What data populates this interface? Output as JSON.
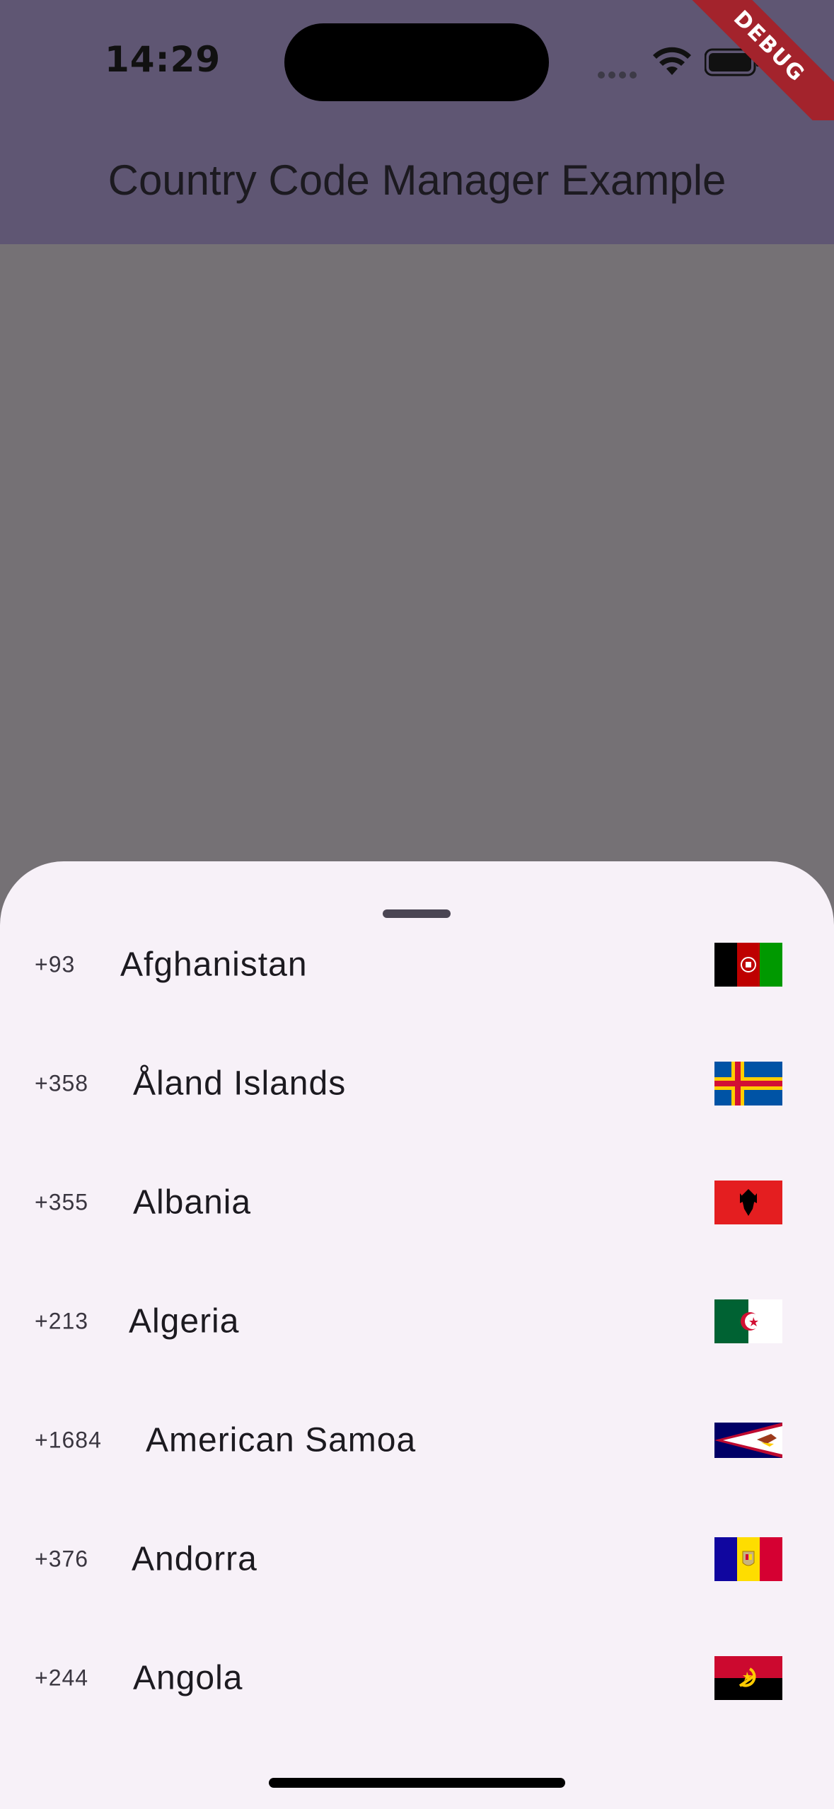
{
  "status_bar": {
    "time": "14:29",
    "icons": [
      "signal-dots-icon",
      "wifi-icon",
      "battery-icon"
    ]
  },
  "debug_banner": "DEBUG",
  "app_bar": {
    "title": "Country Code Manager Example"
  },
  "colors": {
    "app_bar": "#5f5673",
    "scrim": "#757175",
    "sheet": "#f7f1f8",
    "debug": "#a3232c"
  },
  "countries": [
    {
      "code": "+93",
      "name": "Afghanistan",
      "flag": "afghanistan-flag-icon"
    },
    {
      "code": "+358",
      "name": "Åland Islands",
      "flag": "aland-islands-flag-icon"
    },
    {
      "code": "+355",
      "name": "Albania",
      "flag": "albania-flag-icon"
    },
    {
      "code": "+213",
      "name": "Algeria",
      "flag": "algeria-flag-icon"
    },
    {
      "code": "+1684",
      "name": "American Samoa",
      "flag": "american-samoa-flag-icon"
    },
    {
      "code": "+376",
      "name": "Andorra",
      "flag": "andorra-flag-icon"
    },
    {
      "code": "+244",
      "name": "Angola",
      "flag": "angola-flag-icon"
    }
  ]
}
